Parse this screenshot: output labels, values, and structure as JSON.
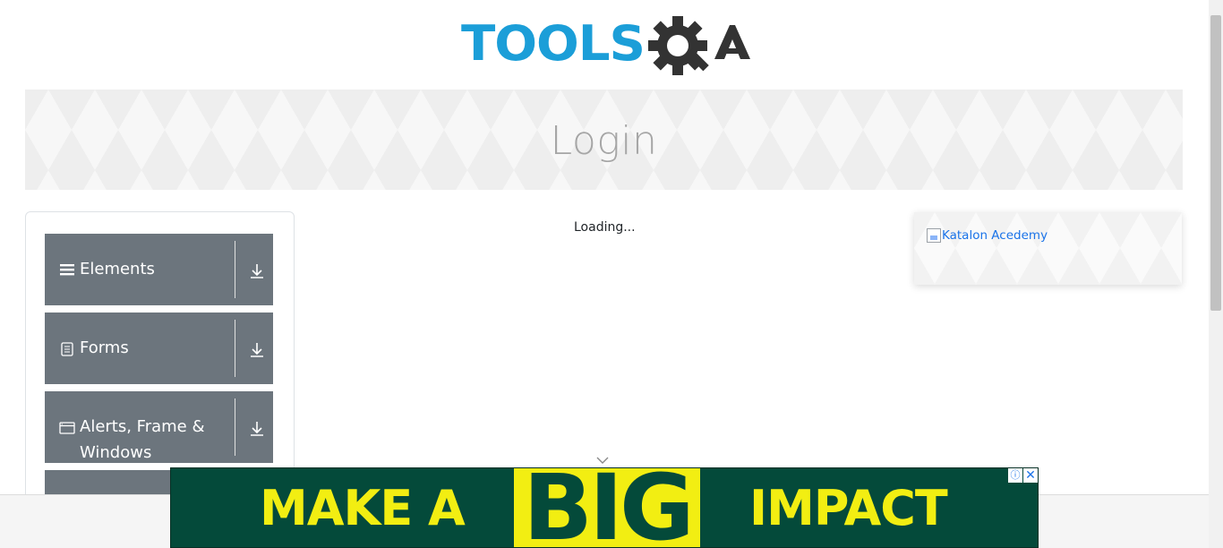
{
  "logo": {
    "text_primary": "TOOLS",
    "text_secondary": "QA",
    "primary_color": "#1b9ed8",
    "secondary_color": "#333333"
  },
  "header": {
    "title": "Login"
  },
  "sidebar": {
    "groups": [
      {
        "label": "Elements",
        "icon": "hamburger-icon"
      },
      {
        "label": "Forms",
        "icon": "document-icon"
      },
      {
        "label": "Alerts, Frame & Windows",
        "icon": "window-icon"
      }
    ]
  },
  "main": {
    "status": "Loading..."
  },
  "right_ad": {
    "alt": "Katalon Acedemy"
  },
  "bottom_ad": {
    "text_left": "MAKE A",
    "text_big": "BIG",
    "text_right": "IMPACT",
    "info_icon": "ⓘ",
    "close_icon": "✕",
    "bg_color": "#044a3a",
    "accent_color": "#f2ee12"
  },
  "colors": {
    "sidebar_bg": "#6c757d",
    "banner_title": "#a6a6a6"
  }
}
